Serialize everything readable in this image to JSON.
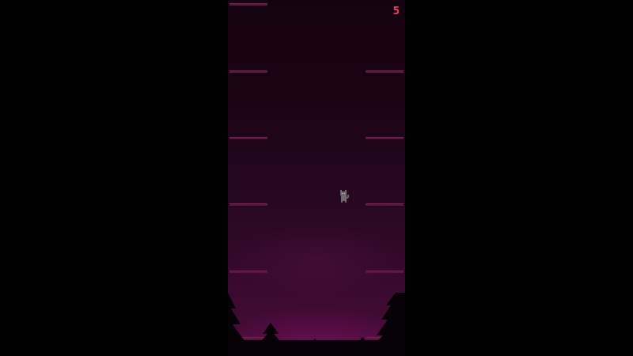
{
  "hud": {
    "score": "5"
  }
}
